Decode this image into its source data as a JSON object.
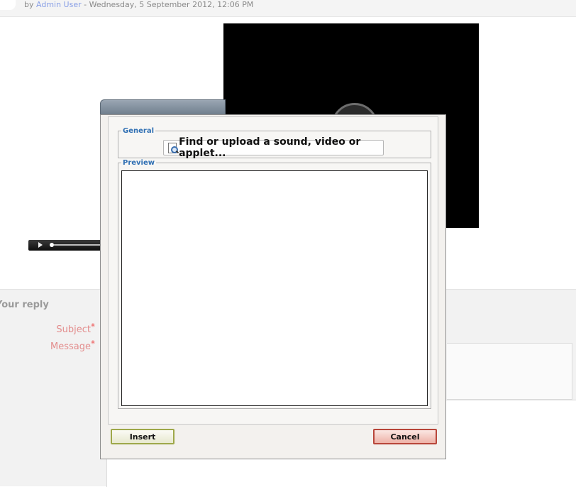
{
  "post": {
    "by_label": "by",
    "author": "Admin User",
    "date_text": "- Wednesday, 5 September 2012, 12:06 PM"
  },
  "reply": {
    "title": "Your reply",
    "subject_label": "Subject",
    "message_label": "Message",
    "required_mark": "*"
  },
  "dialog": {
    "general_legend": "General",
    "find_button_label": "Find or upload a sound, video or applet...",
    "preview_legend": "Preview",
    "insert_label": "Insert",
    "cancel_label": "Cancel"
  },
  "colors": {
    "legend": "#2f6fb3",
    "author_link": "#8aa0e6",
    "required_label": "#e38d8d",
    "insert_border": "#9ea84a",
    "cancel_border": "#b8463a"
  },
  "icons": {
    "find_button": "magnifier-document-icon",
    "media_play": "play-icon"
  }
}
